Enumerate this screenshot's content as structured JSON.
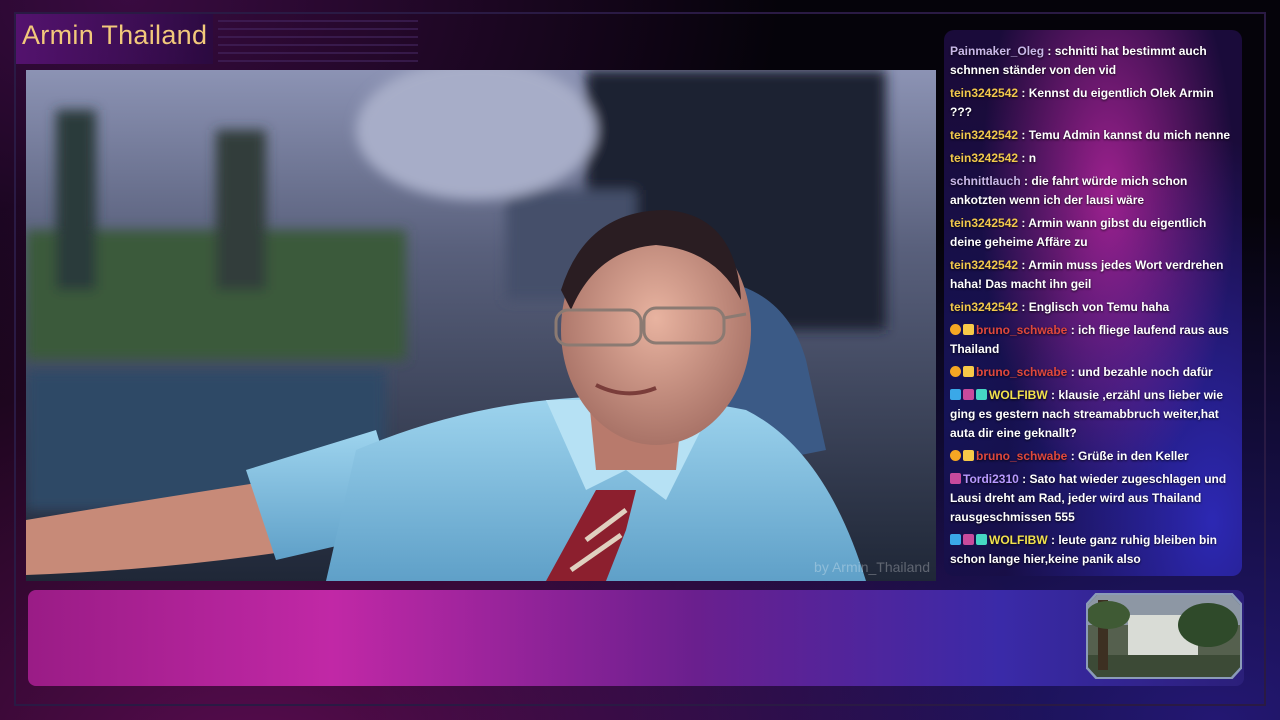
{
  "header": {
    "title": "Armin Thailand"
  },
  "video": {
    "watermark": "by Armin_Thailand"
  },
  "colors": {
    "title_text": "#f2c97b",
    "username_light": "#c9b8e8",
    "username_gold": "#f2c94c",
    "username_red": "#e0483c",
    "username_purple": "#b99aff",
    "username_yellow": "#f2e14c"
  },
  "chat": {
    "messages": [
      {
        "user": "Painmaker_Oleg",
        "color": "#c9b8e8",
        "badges": [],
        "text": "schnitti hat bestimmt auch schnnen ständer von den vid"
      },
      {
        "user": "tein3242542",
        "color": "#f2c94c",
        "badges": [],
        "text": "Kennst du eigentlich Olek Armin ???"
      },
      {
        "user": "tein3242542",
        "color": "#f2c94c",
        "badges": [],
        "text": "Temu Admin kannst du mich nenne"
      },
      {
        "user": "tein3242542",
        "color": "#f2c94c",
        "badges": [],
        "text": "n"
      },
      {
        "user": "schnittlauch",
        "color": "#c9b8e8",
        "badges": [],
        "text": "die fahrt würde mich schon ankotzten wenn ich der lausi wäre"
      },
      {
        "user": "tein3242542",
        "color": "#f2c94c",
        "badges": [],
        "text": "Armin wann gibst du eigentlich deine geheime Affäre zu"
      },
      {
        "user": "tein3242542",
        "color": "#f2c94c",
        "badges": [],
        "text": "Armin muss jedes Wort verdrehen haha! Das macht ihn geil"
      },
      {
        "user": "tein3242542",
        "color": "#f2c94c",
        "badges": [],
        "text": "Englisch von Temu haha"
      },
      {
        "user": "bruno_schwabe",
        "color": "#e0483c",
        "badges": [
          "orange",
          "gold"
        ],
        "text": "ich fliege laufend raus aus Thailand"
      },
      {
        "user": "bruno_schwabe",
        "color": "#e0483c",
        "badges": [
          "orange",
          "gold"
        ],
        "text": "und bezahle noch dafür"
      },
      {
        "user": "WOLFIBW",
        "color": "#f2e14c",
        "badges": [
          "prime",
          "pink",
          "cyan"
        ],
        "text": "klausie ,erzähl uns lieber wie ging es gestern nach streamabbruch weiter,hat auta dir eine geknallt?"
      },
      {
        "user": "bruno_schwabe",
        "color": "#e0483c",
        "badges": [
          "orange",
          "gold"
        ],
        "text": "Grüße in den Keller"
      },
      {
        "user": "Tordi2310",
        "color": "#b99aff",
        "badges": [
          "pink"
        ],
        "text": "Sato hat wieder zugeschlagen und Lausi dreht am Rad, jeder wird aus Thailand rausgeschmissen 555"
      },
      {
        "user": "WOLFIBW",
        "color": "#f2e14c",
        "badges": [
          "prime",
          "pink",
          "cyan"
        ],
        "text": "leute ganz ruhig bleiben bin schon lange hier,keine panik also"
      }
    ]
  }
}
